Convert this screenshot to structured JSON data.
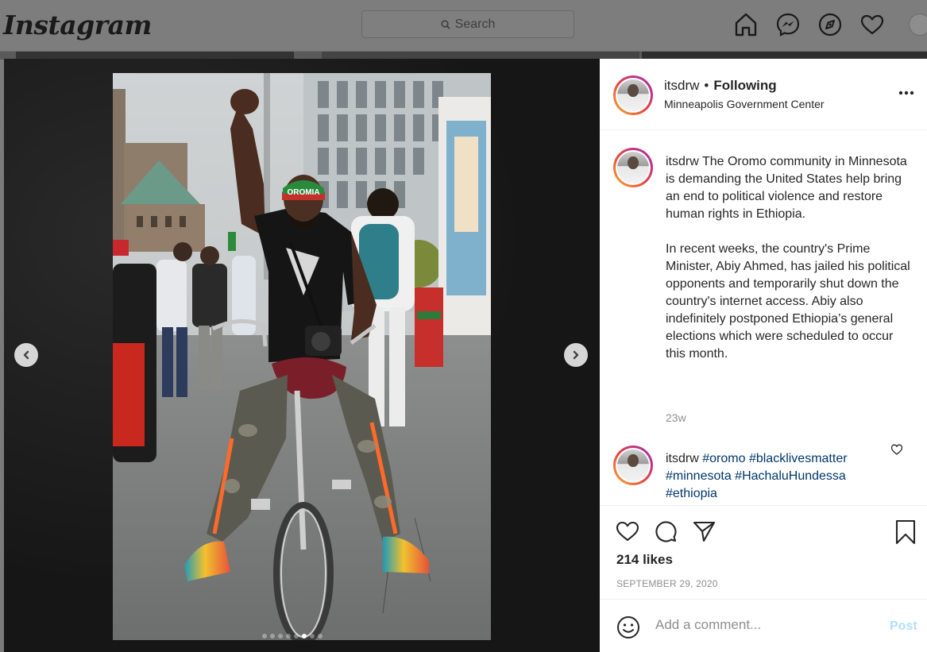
{
  "app": {
    "logo": "Instagram"
  },
  "nav": {
    "search_placeholder": "Search",
    "icons": [
      "home-icon",
      "messenger-icon",
      "explore-icon",
      "activity-heart-icon",
      "profile-avatar"
    ]
  },
  "post": {
    "username": "itsdrw",
    "following_label": "Following",
    "location": "Minneapolis Government Center",
    "caption_username": "itsdrw",
    "caption_paragraph_1": "The Oromo community in Minnesota is demanding the United States help bring an end to political violence and restore human rights in Ethiopia.",
    "caption_paragraph_2": "In recent weeks, the country's Prime Minister, Abiy Ahmed, has jailed his political opponents and temporarily shut down the country's internet access. Abiy also indefinitely postponed Ethiopia’s general elections which were scheduled to occur this month.",
    "caption_time": "23w",
    "comment": {
      "username": "itsdrw",
      "tags": [
        "#oromo",
        "#blacklivesmatter",
        "#minnesota",
        "#HachaluHundessa",
        "#ethiopia"
      ]
    },
    "likes": "214 likes",
    "date": "SEPTEMBER 29, 2020",
    "carousel": {
      "slide_count": 8,
      "active_index": 5
    },
    "image_text": {
      "cap_text": "OROMIA"
    }
  },
  "comment_box": {
    "placeholder": "Add a comment...",
    "post_label": "Post"
  },
  "colors": {
    "link": "#00376b",
    "post_disabled": "#b2dffc",
    "secondary_text": "#8e8e8e"
  }
}
